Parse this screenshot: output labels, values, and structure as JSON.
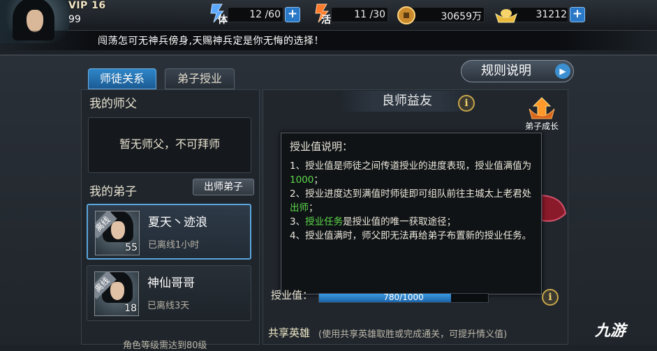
{
  "player": {
    "vip": "VIP 16",
    "level": "99"
  },
  "resources": {
    "stamina": {
      "label": "体",
      "value": "12 /60"
    },
    "vitality": {
      "label": "活",
      "value": "11 /30"
    },
    "coins": {
      "value": "30659万"
    },
    "ingots": {
      "value": "31212"
    }
  },
  "marquee": "闯荡怎可无神兵傍身,天赐神兵定是你无悔的选择！",
  "tabs": [
    "师徒关系",
    "弟子授业"
  ],
  "rules_button": "规则说明",
  "left": {
    "master_title": "我的师父",
    "master_empty": "暂无师父，不可拜师",
    "disciples_title": "我的弟子",
    "graduate_button": "出师弟子",
    "disciples": [
      {
        "name": "夏天丶迹浪",
        "level": "55",
        "status": "已离线1小时",
        "tag": "离线"
      },
      {
        "name": "神仙哥哥",
        "level": "18",
        "status": "已离线3天",
        "tag": "离线"
      }
    ],
    "bottom_cut": "角色等级需达到80级"
  },
  "right": {
    "banner": "良师益友",
    "growth_label": "弟子成长",
    "popup": {
      "title": "授业值说明：",
      "l1a": "1、授业值是师徒之间传道授业的进度表现，授业值满值为",
      "l1b": "1000",
      "l1c": "；",
      "l2a": "2、授业进度达到满值时师徒即可组队前往主城太上老君处",
      "l2b": "出师",
      "l2c": "；",
      "l3a": "3、",
      "l3b": "授业任务",
      "l3c": "是授业值的唯一获取途径；",
      "l4": "4、授业值满时，师父即无法再给弟子布置新的授业任务。"
    },
    "progress_label": "授业值：",
    "progress_text": "780/1000",
    "progress_fraction": 0.78,
    "share_title": "共享英雄",
    "share_note": "(使用共享英雄取胜或完成通关，可提升情义值)"
  },
  "logo": "九游",
  "colors": {
    "accent": "#2e86c8",
    "green": "#5cd84a",
    "gold": "#c9a64a"
  }
}
